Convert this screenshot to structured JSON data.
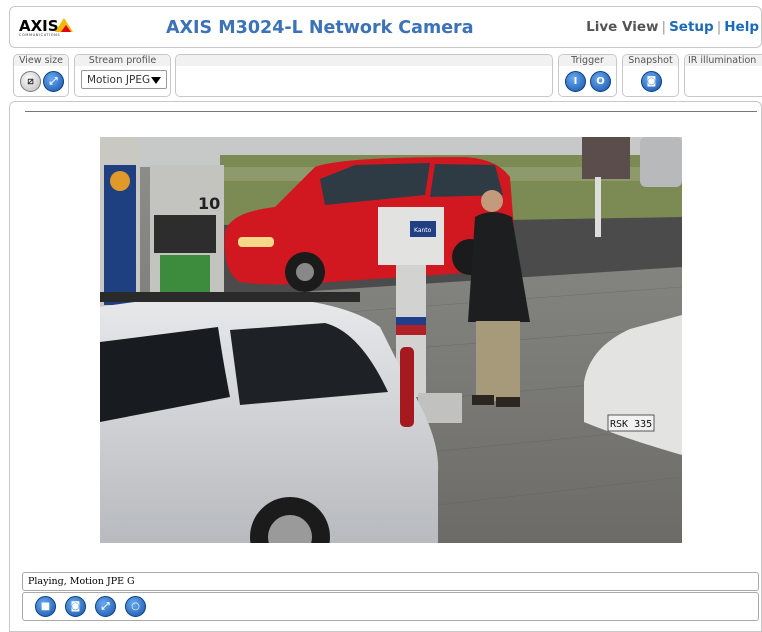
{
  "header": {
    "logo_text": "AXIS",
    "logo_subtext": "COMMUNICATIONS",
    "title": "AXIS M3024-L Network Camera",
    "nav": {
      "live_view": "Live View",
      "separator": "|",
      "setup": "Setup",
      "help": "Help"
    }
  },
  "toolbar": {
    "view_size": {
      "label": "View size",
      "icons": [
        "fit-to-window-icon",
        "full-size-icon"
      ]
    },
    "stream_profile": {
      "label": "Stream profile",
      "selected": "Motion JPEG"
    },
    "trigger": {
      "label": "Trigger",
      "icons": [
        "trigger-on-icon",
        "trigger-off-icon"
      ]
    },
    "snapshot": {
      "label": "Snapshot",
      "icon": "camera-icon"
    },
    "ir_illumination": {
      "label": "IR illumination"
    }
  },
  "video": {
    "description_icon": "live-camera-stream",
    "overlay_sign": "Kanto",
    "pump_number": "10",
    "license_plate": "RSK 335"
  },
  "status": {
    "text": "Playing, Motion JPE G"
  },
  "controls": {
    "icons": [
      "stop-icon",
      "snapshot-icon",
      "fullscreen-icon",
      "record-icon"
    ]
  },
  "colors": {
    "title_blue": "#3b72b8",
    "link_blue": "#1c6bb8",
    "button_blue": "#1452a8",
    "logo_yellow": "#f5b800",
    "logo_red": "#e2001a"
  }
}
